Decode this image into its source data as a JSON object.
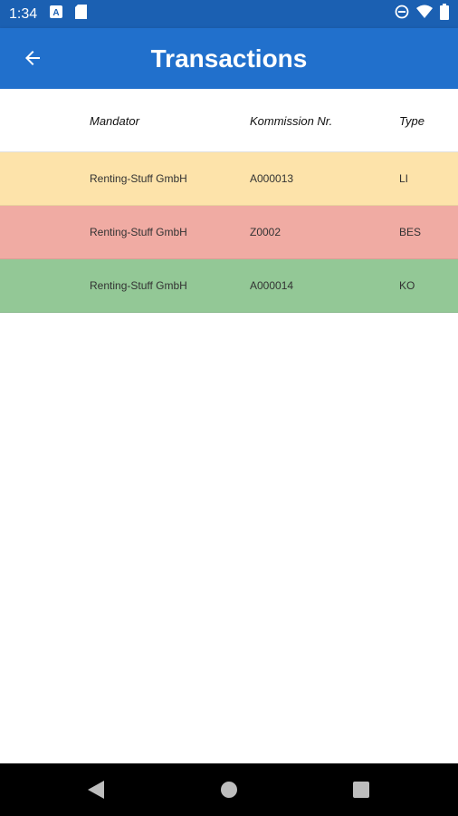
{
  "status": {
    "time": "1:34"
  },
  "appbar": {
    "title": "Transactions"
  },
  "table": {
    "headers": [
      "Mandator",
      "Kommission Nr.",
      "Type"
    ],
    "rows": [
      {
        "mandator": "Renting-Stuff GmbH",
        "kommission": "A000013",
        "type": "LI",
        "color": "#fde3aa"
      },
      {
        "mandator": "Renting-Stuff GmbH",
        "kommission": "Z0002",
        "type": "BES",
        "color": "#f0aba3"
      },
      {
        "mandator": "Renting-Stuff GmbH",
        "kommission": "A000014",
        "type": "KO",
        "color": "#93c896"
      }
    ]
  },
  "colors": {
    "statusbar": "#1b60b2",
    "appbar": "#2170cc"
  },
  "icons": {
    "status_left": [
      "a-badge-icon",
      "sd-card-icon"
    ],
    "status_right": [
      "do-not-disturb-icon",
      "wifi-icon",
      "battery-icon"
    ],
    "nav": [
      "back-triangle-icon",
      "home-circle-icon",
      "recents-square-icon"
    ]
  }
}
